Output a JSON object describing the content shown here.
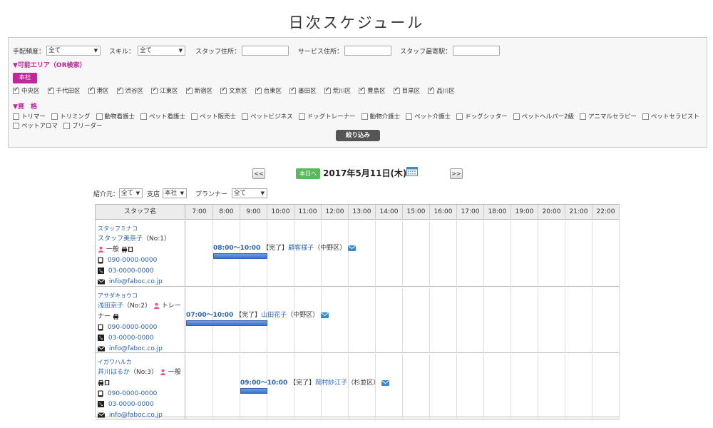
{
  "page_title": "日次スケジュール",
  "filters": {
    "frequency_label": "手配頻度：",
    "frequency_value": "全て",
    "skill_label": "スキル：",
    "skill_value": "全て",
    "staff_address_label": "スタッフ住所：",
    "service_address_label": "サービス住所：",
    "nearest_station_label": "スタッフ最寄駅：",
    "area_heading": "▼可能エリア（OR検索）",
    "branch_button": "本社",
    "areas": [
      "中央区",
      "千代田区",
      "港区",
      "渋谷区",
      "江東区",
      "新宿区",
      "文京区",
      "台東区",
      "墨田区",
      "荒川区",
      "豊島区",
      "目黒区",
      "品川区"
    ],
    "qual_heading": "▼資　格",
    "quals_row1": [
      "トリマー",
      "トリミング",
      "動物看護士",
      "ペット看護士",
      "ペット販売士",
      "ペットビジネス",
      "ドッグトレーナー",
      "動物介護士",
      "ペット介護士",
      "ドッグシッター",
      "ペットヘルパー2級",
      "アニマルセラピー",
      "ペットセラピスト"
    ],
    "quals_row2": [
      "ペットアロマ",
      "ブリーダー"
    ],
    "narrow_button": "絞り込み"
  },
  "nav": {
    "prev": "<<",
    "next": ">>",
    "today": "本日へ",
    "date": "2017年5月11日(木)"
  },
  "sub_filters": {
    "referrer_label": "紹介元：",
    "referrer_value": "全て",
    "branch_label": "支店",
    "branch_value": "本社",
    "planner_label": "プランナー",
    "planner_value": "全て"
  },
  "grid": {
    "staff_header": "スタッフ名",
    "hours": [
      "7:00",
      "8:00",
      "9:00",
      "10:00",
      "11:00",
      "12:00",
      "13:00",
      "14:00",
      "15:00",
      "16:00",
      "17:00",
      "18:00",
      "19:00",
      "20:00",
      "21:00",
      "22:00"
    ]
  },
  "staff": [
    {
      "kana": "スタッフミナコ",
      "name": "スタッフ美奈子",
      "no": "（No:1）",
      "rank": "一般",
      "mobile": "090-0000-0000",
      "phone": "03-0000-0000",
      "email": "info@faboc.co.jp",
      "appt": {
        "time": "08:00〜10:00",
        "status": "【完了】",
        "customer": "顧客様子",
        "area": "（中野区）",
        "start": 8,
        "end": 10
      }
    },
    {
      "kana": "アサダキョウコ",
      "name": "浅田京子",
      "no": "（No:2）",
      "rank": "トレー",
      "rank_cont": "ナー",
      "mobile": "090-0000-0000",
      "phone": "03-0000-0000",
      "email": "info@faboc.co.jp",
      "appt": {
        "time": "07:00〜10:00",
        "status": "【完了】",
        "customer": "山田花子",
        "area": "（中野区）",
        "start": 7,
        "end": 10
      }
    },
    {
      "kana": "イガワハルカ",
      "name": "井川はるか",
      "no": "（No:3）",
      "rank": "一般",
      "mobile": "090-0000-0000",
      "phone": "03-0000-0000",
      "email": "info@faboc.co.jp",
      "appt": {
        "time": "09:00〜10:00",
        "status": "【完了】",
        "customer": "岡村紗江子",
        "area": "（杉並区）",
        "start": 9,
        "end": 10
      }
    }
  ],
  "colors": {
    "accent": "#c0289a",
    "link": "#2a64b5",
    "bar": "#3a74c9",
    "today": "#5cb85c"
  }
}
